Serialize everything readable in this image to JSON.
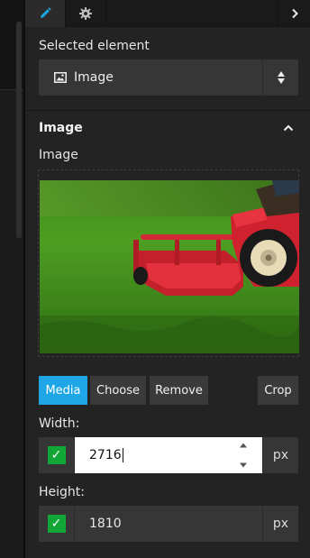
{
  "panel": {
    "selected_element_label": "Selected element",
    "selected_element_value": "Image",
    "section_title": "Image",
    "image_field_label": "Image",
    "buttons": {
      "media": "Media",
      "choose": "Choose",
      "remove": "Remove",
      "crop": "Crop"
    },
    "width": {
      "label": "Width:",
      "value": "2716",
      "unit": "px",
      "checked": true
    },
    "height": {
      "label": "Height:",
      "value": "1810",
      "unit": "px",
      "checked": true
    }
  },
  "icons": {
    "tab_edit": "pencil-icon",
    "tab_settings": "gear-icon",
    "collapse": "chevron-right-icon",
    "select_image": "image-icon",
    "select_arrows": "up-down-arrows-icon",
    "section_toggle": "chevron-up-icon",
    "checkbox": "checkmark-icon"
  },
  "colors": {
    "accent": "#1ea6e6",
    "check": "#12a637",
    "panel_bg": "#232323",
    "field_bg": "#363636"
  }
}
